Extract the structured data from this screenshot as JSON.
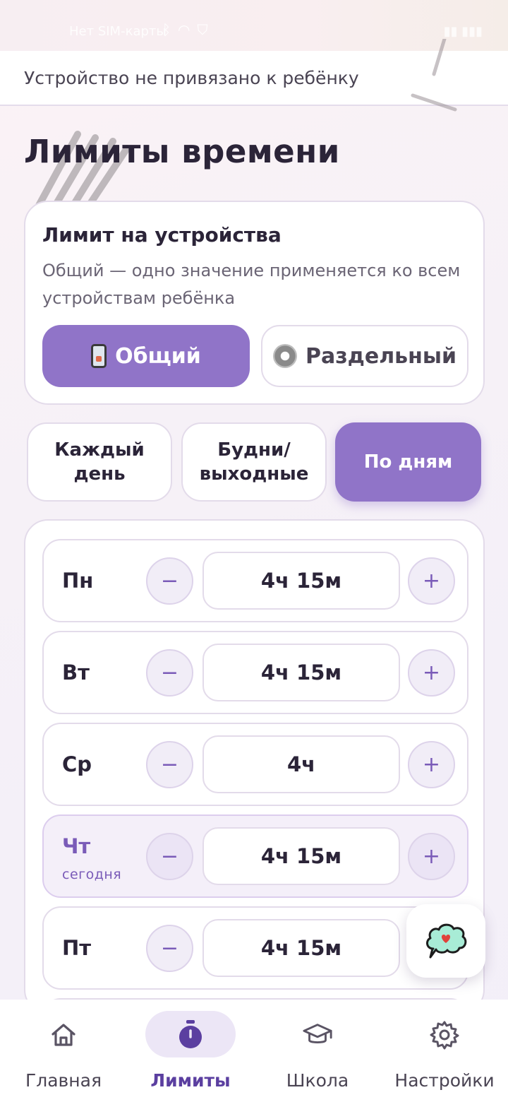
{
  "status_bar": {
    "carrier": "Нет SIM-карты"
  },
  "banner": {
    "text": "Устройство не привязано к ребёнку"
  },
  "page_title": "Лимиты времени",
  "device_limit": {
    "title": "Лимит на устройства",
    "description": "Общий — одно значение применяется ко всем устройствам ребёнка",
    "options": [
      {
        "label": "Общий",
        "icon": "phone-icon",
        "active": true
      },
      {
        "label": "Раздельный",
        "icon": "gear-icon",
        "active": false
      }
    ]
  },
  "schedule_modes": [
    {
      "label": "Каждый день",
      "active": false
    },
    {
      "label": "Будни/ выходные",
      "active": false
    },
    {
      "label": "По дням",
      "active": true
    }
  ],
  "days": [
    {
      "label": "Пн",
      "value": "4ч 15м",
      "today": false,
      "sub": ""
    },
    {
      "label": "Вт",
      "value": "4ч 15м",
      "today": false,
      "sub": ""
    },
    {
      "label": "Ср",
      "value": "4ч",
      "today": false,
      "sub": ""
    },
    {
      "label": "Чт",
      "value": "4ч 15м",
      "today": true,
      "sub": "сегодня"
    },
    {
      "label": "Пт",
      "value": "4ч 15м",
      "today": false,
      "sub": ""
    }
  ],
  "stepper": {
    "minus": "−",
    "plus": "+"
  },
  "nav": [
    {
      "label": "Главная",
      "icon": "home-icon",
      "active": false
    },
    {
      "label": "Лимиты",
      "icon": "stopwatch-icon",
      "active": true
    },
    {
      "label": "Школа",
      "icon": "graduation-cap-icon",
      "active": false
    },
    {
      "label": "Настройки",
      "icon": "gear-icon",
      "active": false
    }
  ],
  "colors": {
    "accent": "#9074c8",
    "accent_dark": "#5b3fa0",
    "border": "#e3dbea"
  }
}
